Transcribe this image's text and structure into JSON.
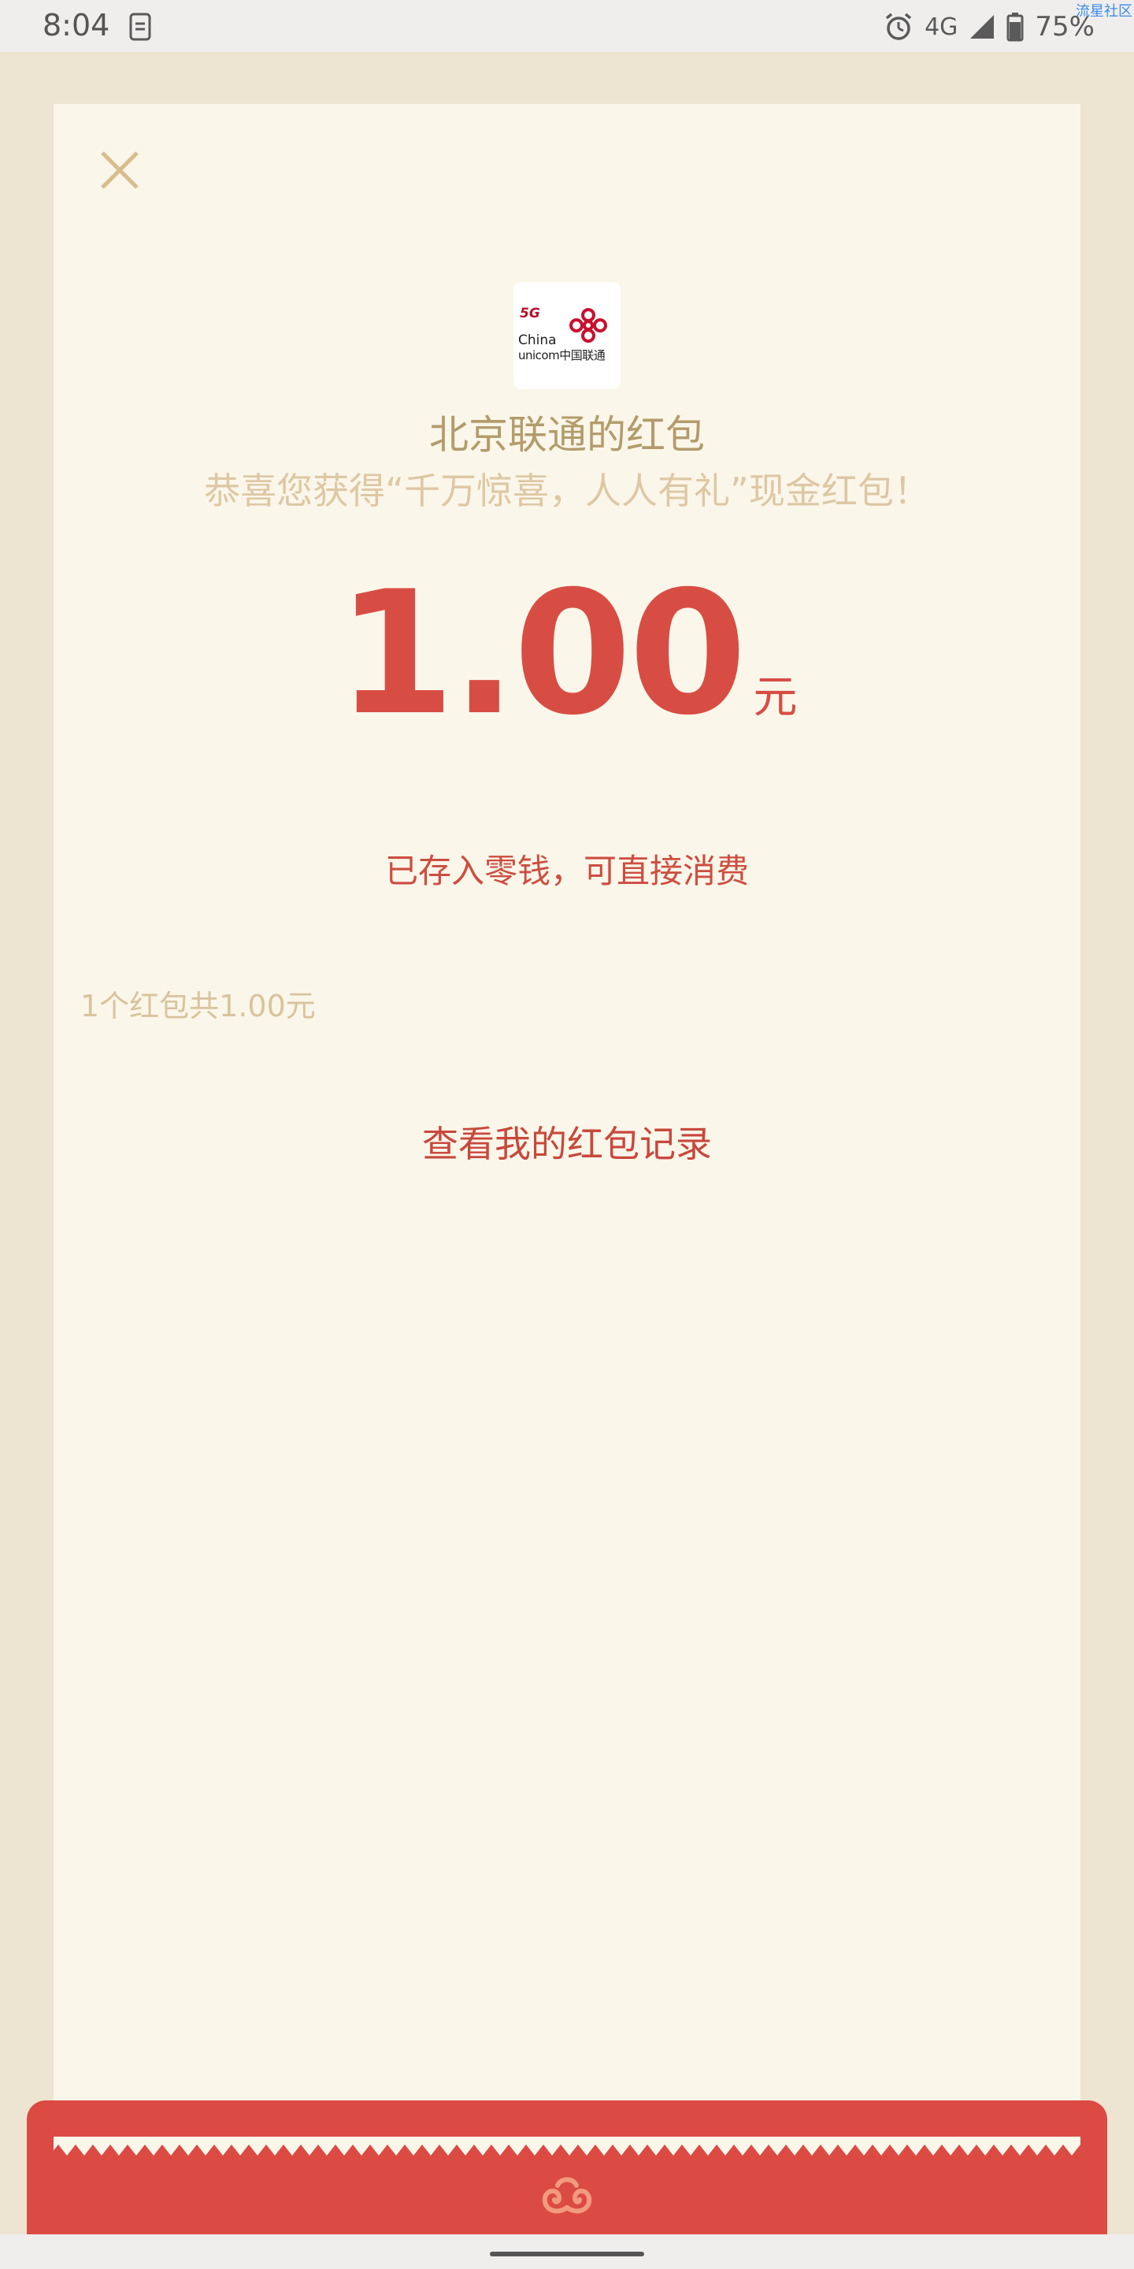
{
  "status_bar": {
    "time": "8:04",
    "network": "4G",
    "battery": "75%",
    "watermark": "流星社区"
  },
  "header": {
    "logo": {
      "tag": "5G",
      "line1": "China",
      "line2": "unicom中国联通"
    },
    "title": "北京联通的红包",
    "subtitle": "恭喜您获得“千万惊喜，人人有礼”现金红包！"
  },
  "amount": {
    "value": "1.00",
    "unit": "元",
    "note": "已存入零钱，可直接消费"
  },
  "summary": "1个红包共1.00元",
  "record_link": "查看我的红包记录",
  "colors": {
    "page_bg": "#ede5d2",
    "card_bg": "#fbf6ea",
    "accent_red": "#d84d43",
    "gold_text": "#b29c6a",
    "close_icon": "#d8bd8c"
  }
}
